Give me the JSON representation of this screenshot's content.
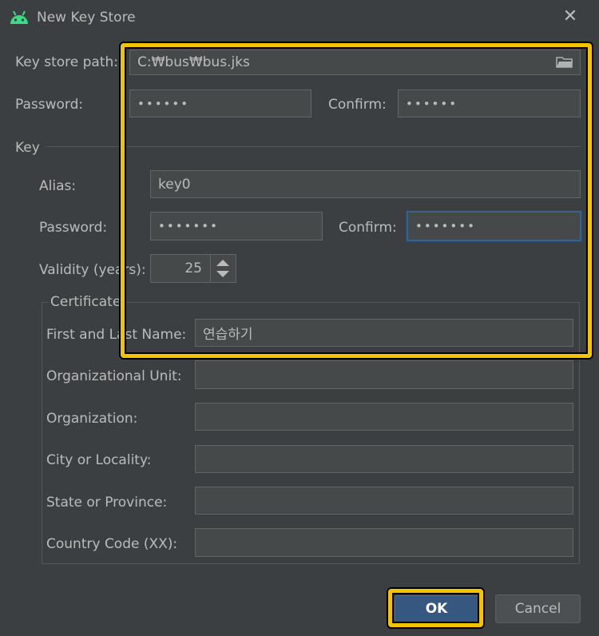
{
  "window": {
    "title": "New Key Store",
    "icon": "android-icon",
    "close_icon": "close-icon"
  },
  "keystore": {
    "path_label": "Key store path:",
    "path_value": "C:₩bus₩bus.jks",
    "password_label": "Password:",
    "password_value": "••••••",
    "confirm_label": "Confirm:",
    "confirm_value": "••••••"
  },
  "key": {
    "section_label": "Key",
    "alias_label": "Alias:",
    "alias_value": "key0",
    "password_label": "Password:",
    "password_value": "•••••••",
    "confirm_label": "Confirm:",
    "confirm_value": "•••••••",
    "validity_label": "Validity (years):",
    "validity_value": "25"
  },
  "certificate": {
    "section_label": "Certificate",
    "fields": [
      {
        "label": "First and Last Name:",
        "value": "연습하기"
      },
      {
        "label": "Organizational Unit:",
        "value": ""
      },
      {
        "label": "Organization:",
        "value": ""
      },
      {
        "label": "City or Locality:",
        "value": ""
      },
      {
        "label": "State or Province:",
        "value": ""
      },
      {
        "label": "Country Code (XX):",
        "value": ""
      }
    ]
  },
  "buttons": {
    "ok": "OK",
    "cancel": "Cancel"
  },
  "colors": {
    "background": "#3c3f41",
    "highlight": "#f3c300",
    "ok_button": "#365880",
    "focus_border": "#3d6185"
  }
}
